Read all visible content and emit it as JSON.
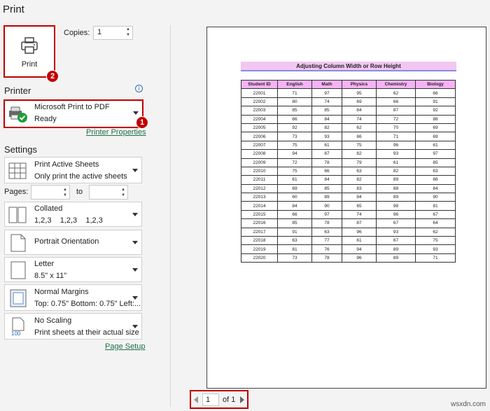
{
  "header": {
    "title": "Print"
  },
  "print_button": {
    "label": "Print",
    "badge": "2"
  },
  "copies": {
    "label": "Copies:",
    "value": "1"
  },
  "printer": {
    "section_title": "Printer",
    "name": "Microsoft Print to PDF",
    "status": "Ready",
    "badge": "1",
    "properties_link": "Printer Properties"
  },
  "settings": {
    "section_title": "Settings",
    "sheets": {
      "line1": "Print Active Sheets",
      "line2": "Only print the active sheets"
    },
    "pages": {
      "label": "Pages:",
      "to_label": "to",
      "from_value": "",
      "to_value": ""
    },
    "collation": {
      "line1": "Collated",
      "line2": "1,2,3    1,2,3    1,2,3"
    },
    "orientation": {
      "line1": "Portrait Orientation"
    },
    "paper": {
      "line1": "Letter",
      "line2": "8.5\" x 11\""
    },
    "margins": {
      "line1": "Normal Margins",
      "line2": "Top: 0.75\" Bottom: 0.75\" Left:..."
    },
    "scaling": {
      "line1": "No Scaling",
      "line2": "Print sheets at their actual size",
      "icon_text": "100"
    },
    "page_setup_link": "Page Setup"
  },
  "preview": {
    "sheet_title": "Adjusting Column Width or Row Height",
    "columns": [
      "Student ID",
      "English",
      "Math",
      "Physics",
      "Chemistry",
      "Biology"
    ],
    "rows": [
      [
        "22001",
        "71",
        "97",
        "95",
        "62",
        "66"
      ],
      [
        "22002",
        "80",
        "74",
        "69",
        "66",
        "91"
      ],
      [
        "22003",
        "85",
        "85",
        "84",
        "87",
        "92"
      ],
      [
        "22004",
        "66",
        "84",
        "74",
        "72",
        "88"
      ],
      [
        "22005",
        "92",
        "82",
        "62",
        "70",
        "69"
      ],
      [
        "22006",
        "73",
        "93",
        "86",
        "71",
        "69"
      ],
      [
        "22007",
        "75",
        "61",
        "75",
        "96",
        "61"
      ],
      [
        "22008",
        "94",
        "87",
        "82",
        "93",
        "97"
      ],
      [
        "22009",
        "72",
        "78",
        "79",
        "61",
        "85"
      ],
      [
        "22010",
        "75",
        "66",
        "63",
        "82",
        "63"
      ],
      [
        "22011",
        "61",
        "84",
        "82",
        "89",
        "86"
      ],
      [
        "22012",
        "69",
        "85",
        "83",
        "88",
        "84"
      ],
      [
        "22013",
        "60",
        "89",
        "84",
        "89",
        "90"
      ],
      [
        "22014",
        "84",
        "90",
        "65",
        "98",
        "81"
      ],
      [
        "22015",
        "66",
        "97",
        "74",
        "96",
        "67"
      ],
      [
        "22016",
        "85",
        "78",
        "87",
        "67",
        "64"
      ],
      [
        "22017",
        "91",
        "63",
        "96",
        "93",
        "62"
      ],
      [
        "22018",
        "63",
        "77",
        "61",
        "67",
        "75"
      ],
      [
        "22019",
        "81",
        "76",
        "94",
        "89",
        "93"
      ],
      [
        "22020",
        "73",
        "78",
        "96",
        "89",
        "71"
      ]
    ]
  },
  "pagination": {
    "current": "1",
    "of_label": "of 1"
  },
  "watermark": "wsxdn.com",
  "colors": {
    "highlight_border": "#c00000",
    "header_fill": "#f5b3f5",
    "title_fill": "#f2c6f2",
    "link": "#1e7145"
  }
}
